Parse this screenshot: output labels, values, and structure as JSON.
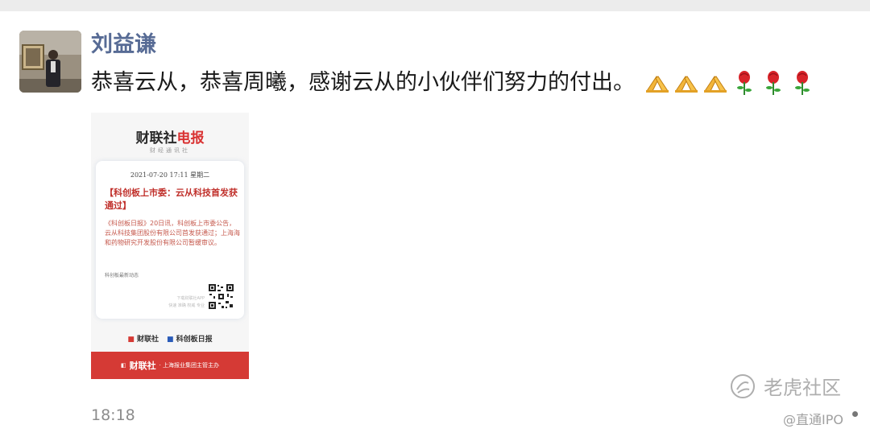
{
  "post": {
    "author": "刘益谦",
    "message": "恭喜云从，恭喜周曦，感谢云从的小伙伴们努力的付出。",
    "emojis": [
      "pray-icon",
      "pray-icon",
      "pray-icon",
      "rose-icon",
      "rose-icon",
      "rose-icon"
    ],
    "time": "18:18"
  },
  "card": {
    "logo_black": "财联社",
    "logo_red": "电报",
    "subtitle": "财经通讯社",
    "date": "2021-07-20 17:11 星期二",
    "headline": "【科创板上市委：云从科技首发获通过】",
    "body": "《科创板日报》20日讯，科创板上市委公告，云从科技集团股份有限公司首发获通过；上海海和药物研究开发股份有限公司暂缓审议。",
    "tag": "科创板最新动态",
    "app_line1": "下载财联社APP",
    "app_line2": "快速 准确 权威 专业",
    "brand1": "财联社",
    "brand2": "科创板日报",
    "footer_brand": "财联社",
    "footer_text": "· 上海报业集团主管主办"
  },
  "watermark": {
    "main": "老虎社区",
    "sub": "@直通IPO"
  },
  "colors": {
    "author": "#576b95",
    "accent_red": "#d53a35"
  }
}
